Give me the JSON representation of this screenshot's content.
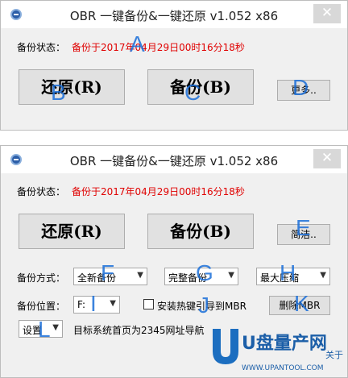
{
  "window1": {
    "title": "OBR 一键备份&一键还原 v1.052 x86",
    "close": "✕",
    "status_label": "备份状态：",
    "status_value": "备份于2017年04月29日00时16分18秒",
    "restore_label": "还原(R)",
    "backup_label": "备份(B)",
    "more_label": "更多..",
    "markers": [
      "A",
      "B",
      "C",
      "D"
    ]
  },
  "window2": {
    "title": "OBR 一键备份&一键还原 v1.052 x86",
    "close": "✕",
    "status_label": "备份状态：",
    "status_value": "备份于2017年04月29日00时16分18秒",
    "restore_label": "还原(R)",
    "backup_label": "备份(B)",
    "simple_label": "简洁..",
    "backup_mode_label": "备份方式：",
    "backup_mode_value": "全新备份",
    "integrity_value": "完整备份",
    "compression_value": "最大压缩",
    "backup_location_label": "备份位置：",
    "drive_value": "F:",
    "hotkey_label": "安装热键引导到MBR",
    "delete_mbr_label": "删除MBR",
    "settings_value": "设置",
    "homepage_text": "目标系统首页为2345网址导航",
    "markers": [
      "E",
      "F",
      "G",
      "H",
      "I",
      "J",
      "K",
      "L"
    ]
  },
  "watermark": {
    "brand": "U盘量产网",
    "about": "关于",
    "url": "WWW.UPANTOOL.COM"
  },
  "colors": {
    "status_red": "#e00000",
    "marker_blue": "#1b6fd9"
  }
}
